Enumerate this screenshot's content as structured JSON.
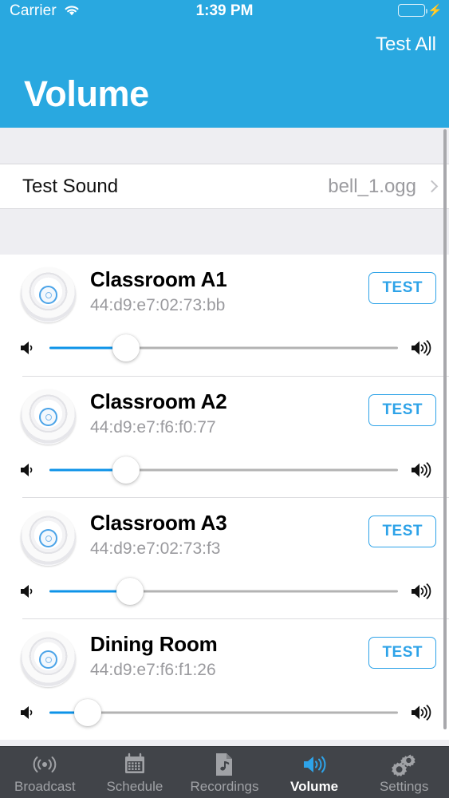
{
  "status_bar": {
    "carrier": "Carrier",
    "time": "1:39 PM",
    "wifi_icon": "wifi-icon",
    "battery_icon": "battery-full-icon",
    "charging_icon": "lightning-bolt-icon"
  },
  "header": {
    "title": "Volume",
    "test_all_label": "Test All",
    "background_color": "#29a8e0"
  },
  "settings_row": {
    "label": "Test Sound",
    "value": "bell_1.ogg",
    "chevron_icon": "chevron-right-icon"
  },
  "devices": [
    {
      "name": "Classroom A1",
      "mac": "44:d9:e7:02:73:bb",
      "test_label": "TEST",
      "volume_percent": 22,
      "device_icon": "access-point-icon",
      "min_icon": "speaker-low-icon",
      "max_icon": "speaker-high-icon"
    },
    {
      "name": "Classroom A2",
      "mac": "44:d9:e7:f6:f0:77",
      "test_label": "TEST",
      "volume_percent": 22,
      "device_icon": "access-point-icon",
      "min_icon": "speaker-low-icon",
      "max_icon": "speaker-high-icon"
    },
    {
      "name": "Classroom A3",
      "mac": "44:d9:e7:02:73:f3",
      "test_label": "TEST",
      "volume_percent": 23,
      "device_icon": "access-point-icon",
      "min_icon": "speaker-low-icon",
      "max_icon": "speaker-high-icon"
    },
    {
      "name": "Dining Room",
      "mac": "44:d9:e7:f6:f1:26",
      "test_label": "TEST",
      "volume_percent": 11,
      "device_icon": "access-point-icon",
      "min_icon": "speaker-low-icon",
      "max_icon": "speaker-high-icon"
    }
  ],
  "tabs": [
    {
      "label": "Broadcast",
      "icon": "broadcast-icon",
      "active": false
    },
    {
      "label": "Schedule",
      "icon": "calendar-icon",
      "active": false
    },
    {
      "label": "Recordings",
      "icon": "audio-file-icon",
      "active": false
    },
    {
      "label": "Volume",
      "icon": "speaker-icon",
      "active": true
    },
    {
      "label": "Settings",
      "icon": "gears-icon",
      "active": false
    }
  ],
  "colors": {
    "accent": "#2ea3e8",
    "slider_fill": "#0d93e8",
    "tabbar_bg": "#414449",
    "group_bg": "#eeeef2",
    "battery_green": "#4cd964"
  }
}
